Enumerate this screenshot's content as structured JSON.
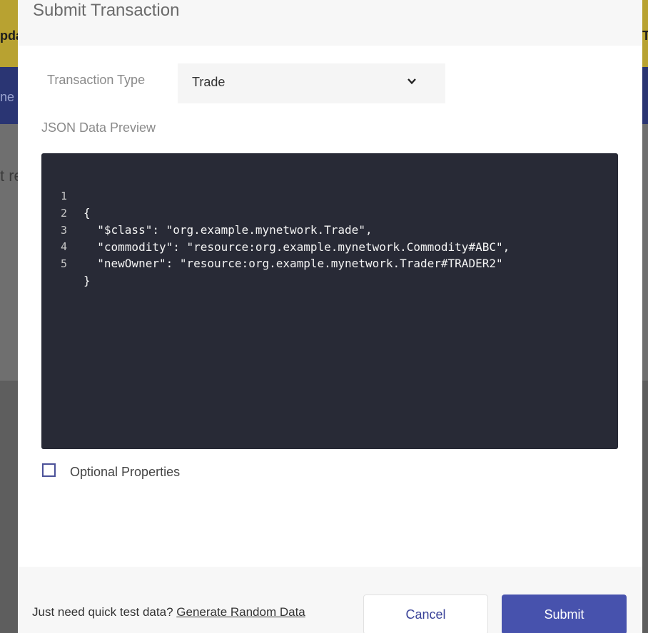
{
  "background": {
    "header_fragment": "pda",
    "right_fragment": "T",
    "nav_fragment": "ne",
    "content_fragment": "t re"
  },
  "modal": {
    "title": "Submit Transaction",
    "transaction_type": {
      "label": "Transaction Type",
      "selected": "Trade",
      "icon": "chevron-down-icon"
    },
    "json_preview": {
      "label": "JSON Data Preview",
      "lines": [
        {
          "num": "1",
          "text": "{"
        },
        {
          "num": "2",
          "text": "  \"$class\": \"org.example.mynetwork.Trade\","
        },
        {
          "num": "3",
          "text": "  \"commodity\": \"resource:org.example.mynetwork.Commodity#ABC\","
        },
        {
          "num": "4",
          "text": "  \"newOwner\": \"resource:org.example.mynetwork.Trader#TRADER2\""
        },
        {
          "num": "5",
          "text": "}"
        }
      ]
    },
    "optional_properties": {
      "label": "Optional Properties",
      "checked": false
    },
    "footer": {
      "quick_test_text": "Just need quick test data?",
      "generate_link": "Generate Random Data",
      "cancel_label": "Cancel",
      "submit_label": "Submit"
    }
  },
  "colors": {
    "accent": "#4752ad",
    "editor_bg": "#282a36"
  }
}
